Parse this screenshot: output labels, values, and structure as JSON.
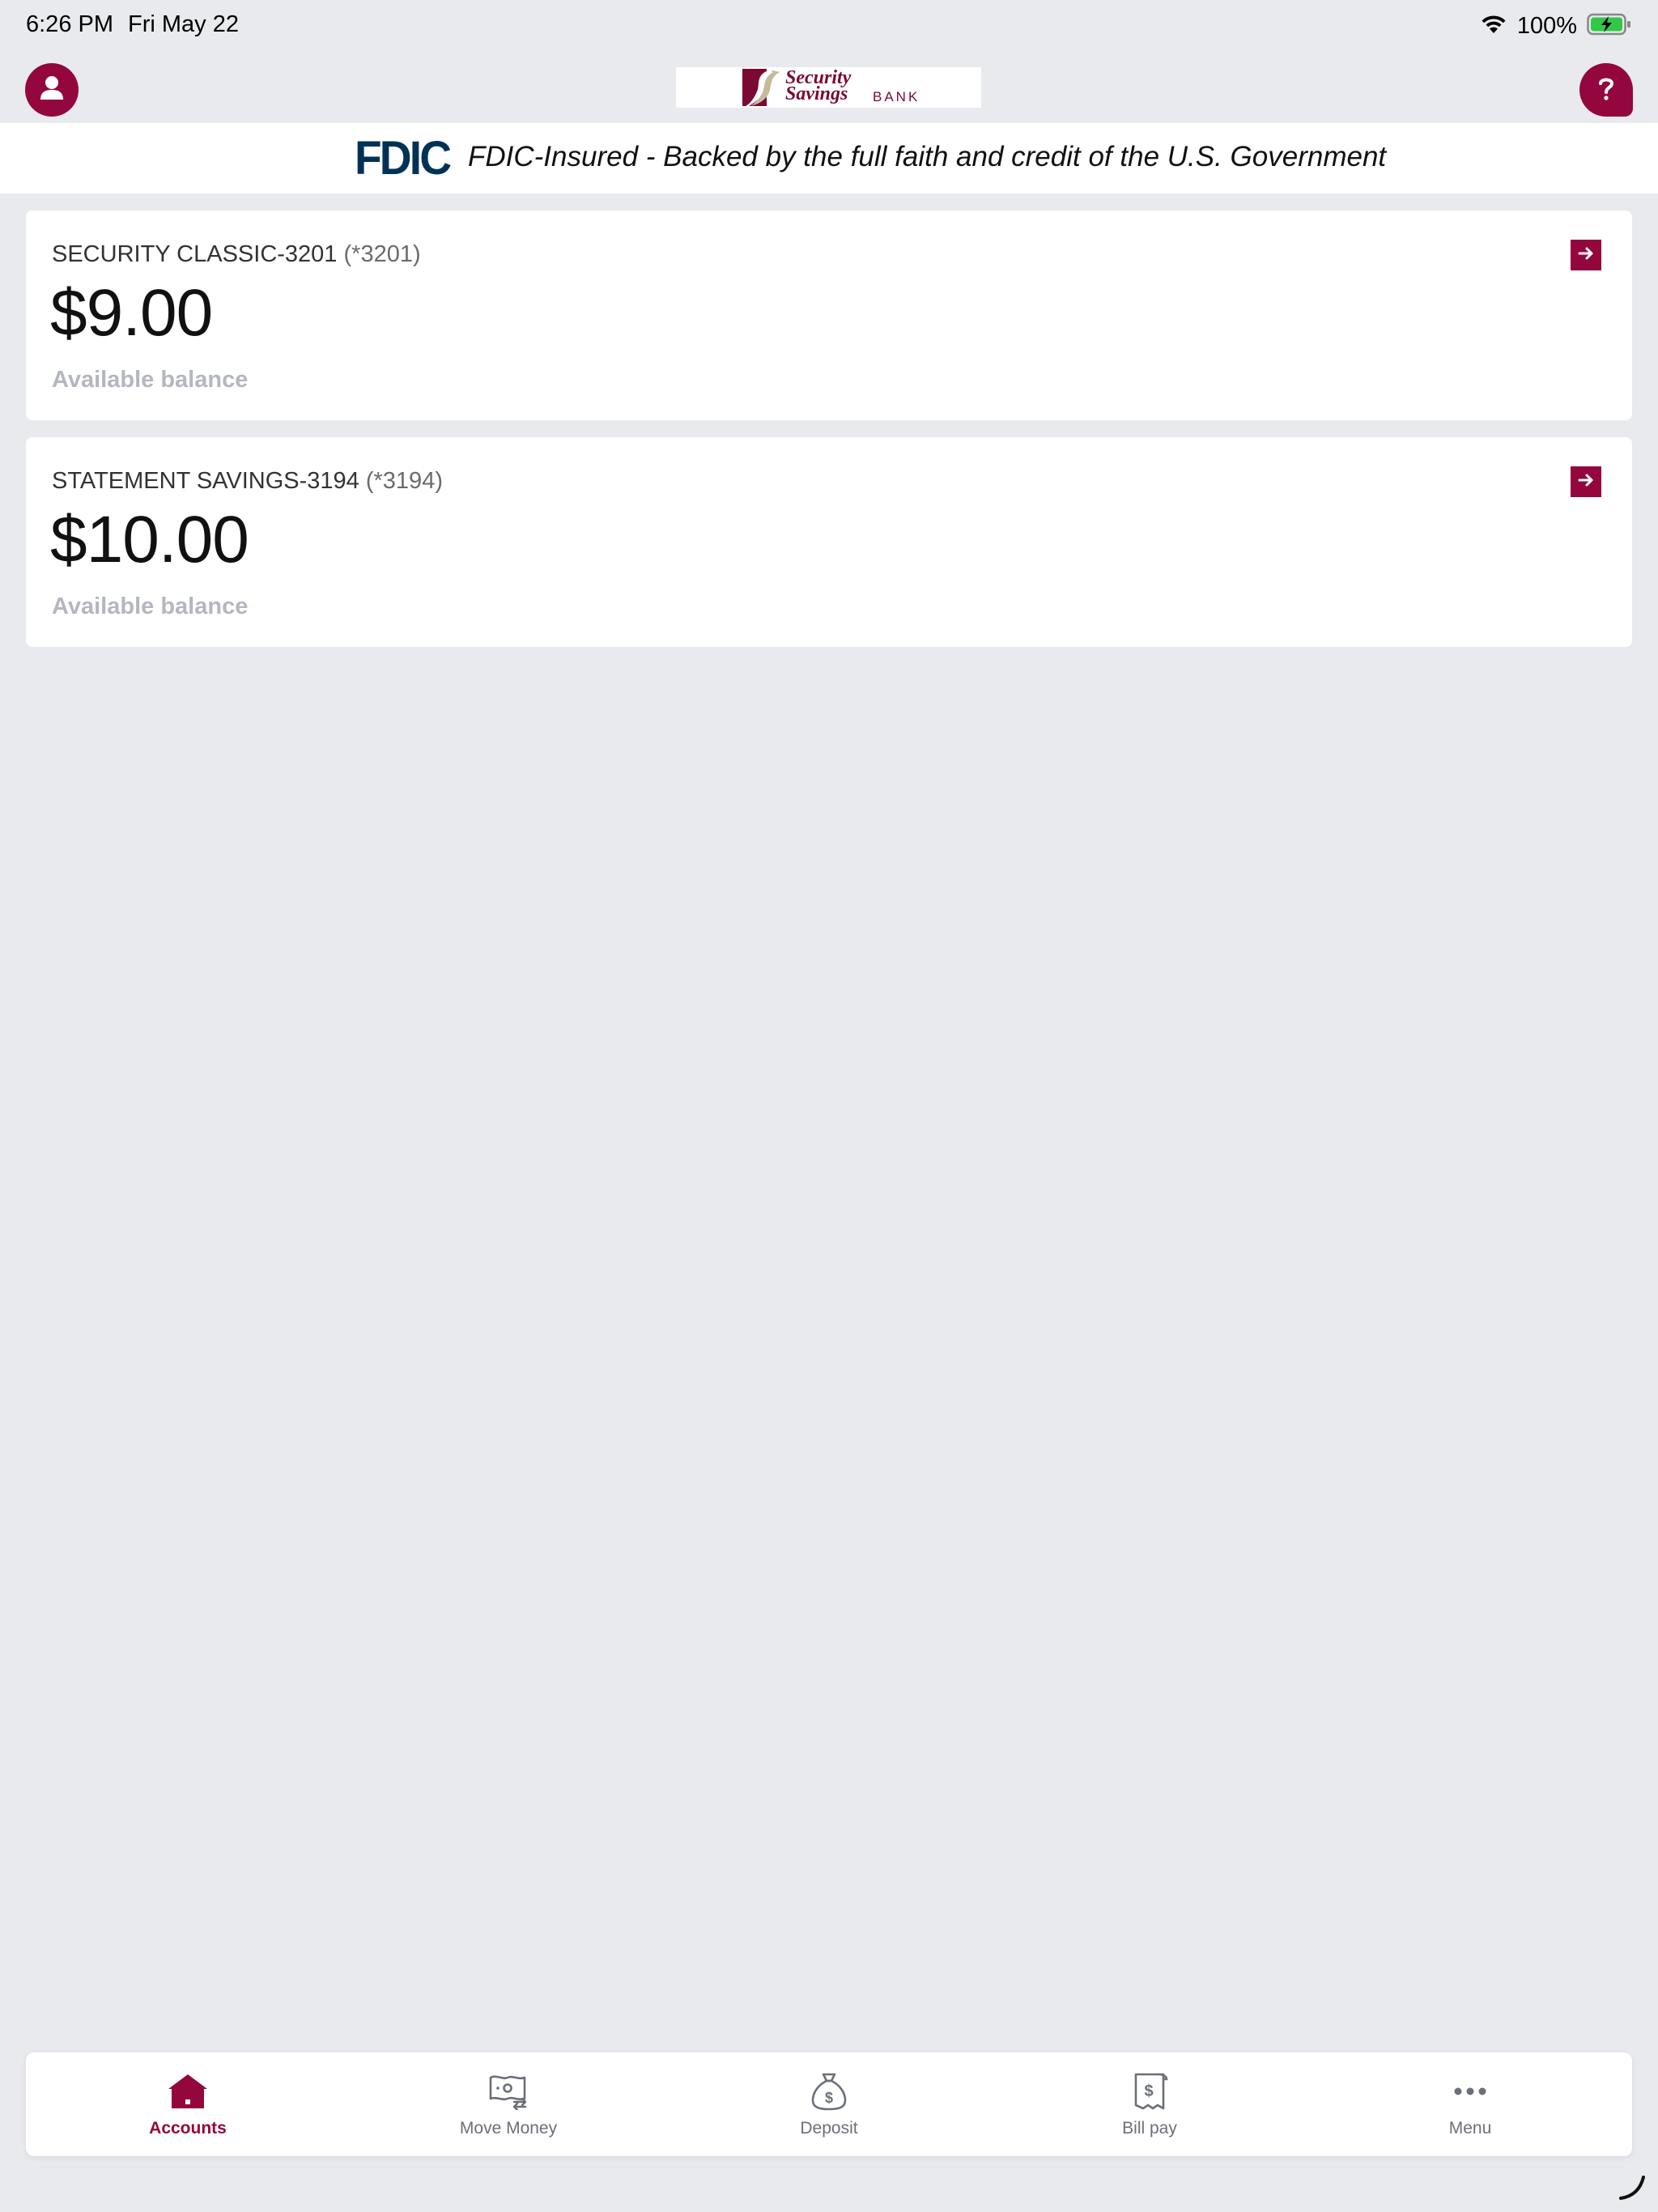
{
  "status_bar": {
    "time": "6:26 PM",
    "date": "Fri May 22",
    "battery_percent": "100%",
    "icons": [
      "wifi-icon",
      "battery-charging-icon"
    ]
  },
  "header": {
    "profile_icon": "person-icon",
    "help_icon": "question-icon",
    "logo": {
      "line1": "Security",
      "line2": "Savings",
      "line3": "BANK"
    },
    "brand_color": "#93073e"
  },
  "fdic": {
    "logo_text": "FDIC",
    "text": "FDIC-Insured - Backed by the full faith and credit of the U.S. Government"
  },
  "accounts": [
    {
      "name": "SECURITY CLASSIC-3201",
      "mask": "(*3201)",
      "balance": "$9.00",
      "balance_label": "Available balance"
    },
    {
      "name": "STATEMENT SAVINGS-3194",
      "mask": "(*3194)",
      "balance": "$10.00",
      "balance_label": "Available balance"
    }
  ],
  "bottom_nav": {
    "items": [
      {
        "label": "Accounts",
        "icon": "home-icon",
        "active": true
      },
      {
        "label": "Move Money",
        "icon": "money-transfer-icon",
        "active": false
      },
      {
        "label": "Deposit",
        "icon": "money-bag-icon",
        "active": false
      },
      {
        "label": "Bill pay",
        "icon": "receipt-icon",
        "active": false
      },
      {
        "label": "Menu",
        "icon": "more-dots-icon",
        "active": false
      }
    ]
  }
}
